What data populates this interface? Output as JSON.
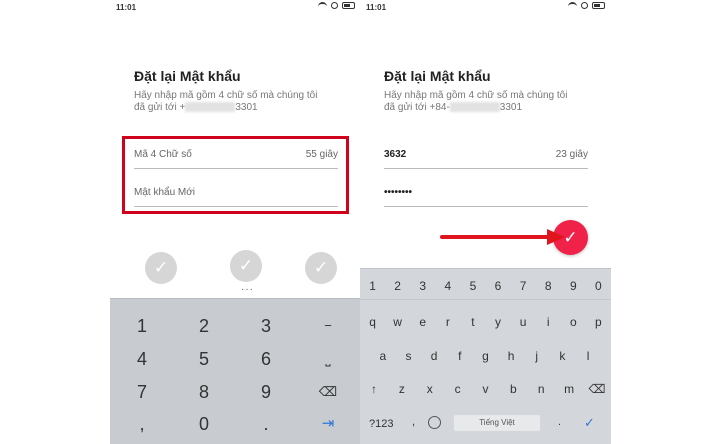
{
  "status_bar": {
    "time": "11:01"
  },
  "screen_left": {
    "title": "Đặt lại Mật khẩu",
    "desc_line1": "Hãy nhập mã gồm 4 chữ số mà chúng tôi",
    "desc_line2_prefix": "đã gửi tới +",
    "desc_line2_suffix": "3301",
    "code_field": {
      "placeholder": "Mã 4 Chữ số",
      "timer": "55 giây"
    },
    "password_field": {
      "placeholder": "Mật khẩu Mới"
    },
    "check_icon": "✓",
    "dots": "···",
    "numpad": {
      "keys": [
        "1",
        "2",
        "3",
        "−",
        "4",
        "5",
        "6",
        "⎵",
        "7",
        "8",
        "9",
        "⌫",
        ",",
        "0",
        ".",
        "⇥"
      ]
    }
  },
  "screen_right": {
    "title": "Đặt lại Mật khẩu",
    "desc_line1": "Hãy nhập mã gồm 4 chữ số mà chúng tôi",
    "desc_line2_prefix": "đã gửi tới +84-",
    "desc_line2_suffix": "3301",
    "code_field": {
      "value": "3632",
      "timer": "23 giây"
    },
    "password_field": {
      "value": "••••••••"
    },
    "submit_icon": "✓",
    "keyboard": {
      "digits": [
        "1",
        "2",
        "3",
        "4",
        "5",
        "6",
        "7",
        "8",
        "9",
        "0"
      ],
      "row1": [
        "q",
        "w",
        "e",
        "r",
        "t",
        "y",
        "u",
        "i",
        "o",
        "p"
      ],
      "row2": [
        "a",
        "s",
        "d",
        "f",
        "g",
        "h",
        "j",
        "k",
        "l"
      ],
      "row3": [
        "↑",
        "z",
        "x",
        "c",
        "v",
        "b",
        "n",
        "m",
        "⌫"
      ],
      "sym_key": "?123",
      "comma": ",",
      "space_label": "Tiếng Việt",
      "period": ".",
      "done_icon": "✓"
    }
  },
  "colors": {
    "highlight_border": "#d0021b",
    "submit_button": "#f0224a",
    "arrow": "#e0161f",
    "accent_blue": "#2f78d6"
  }
}
